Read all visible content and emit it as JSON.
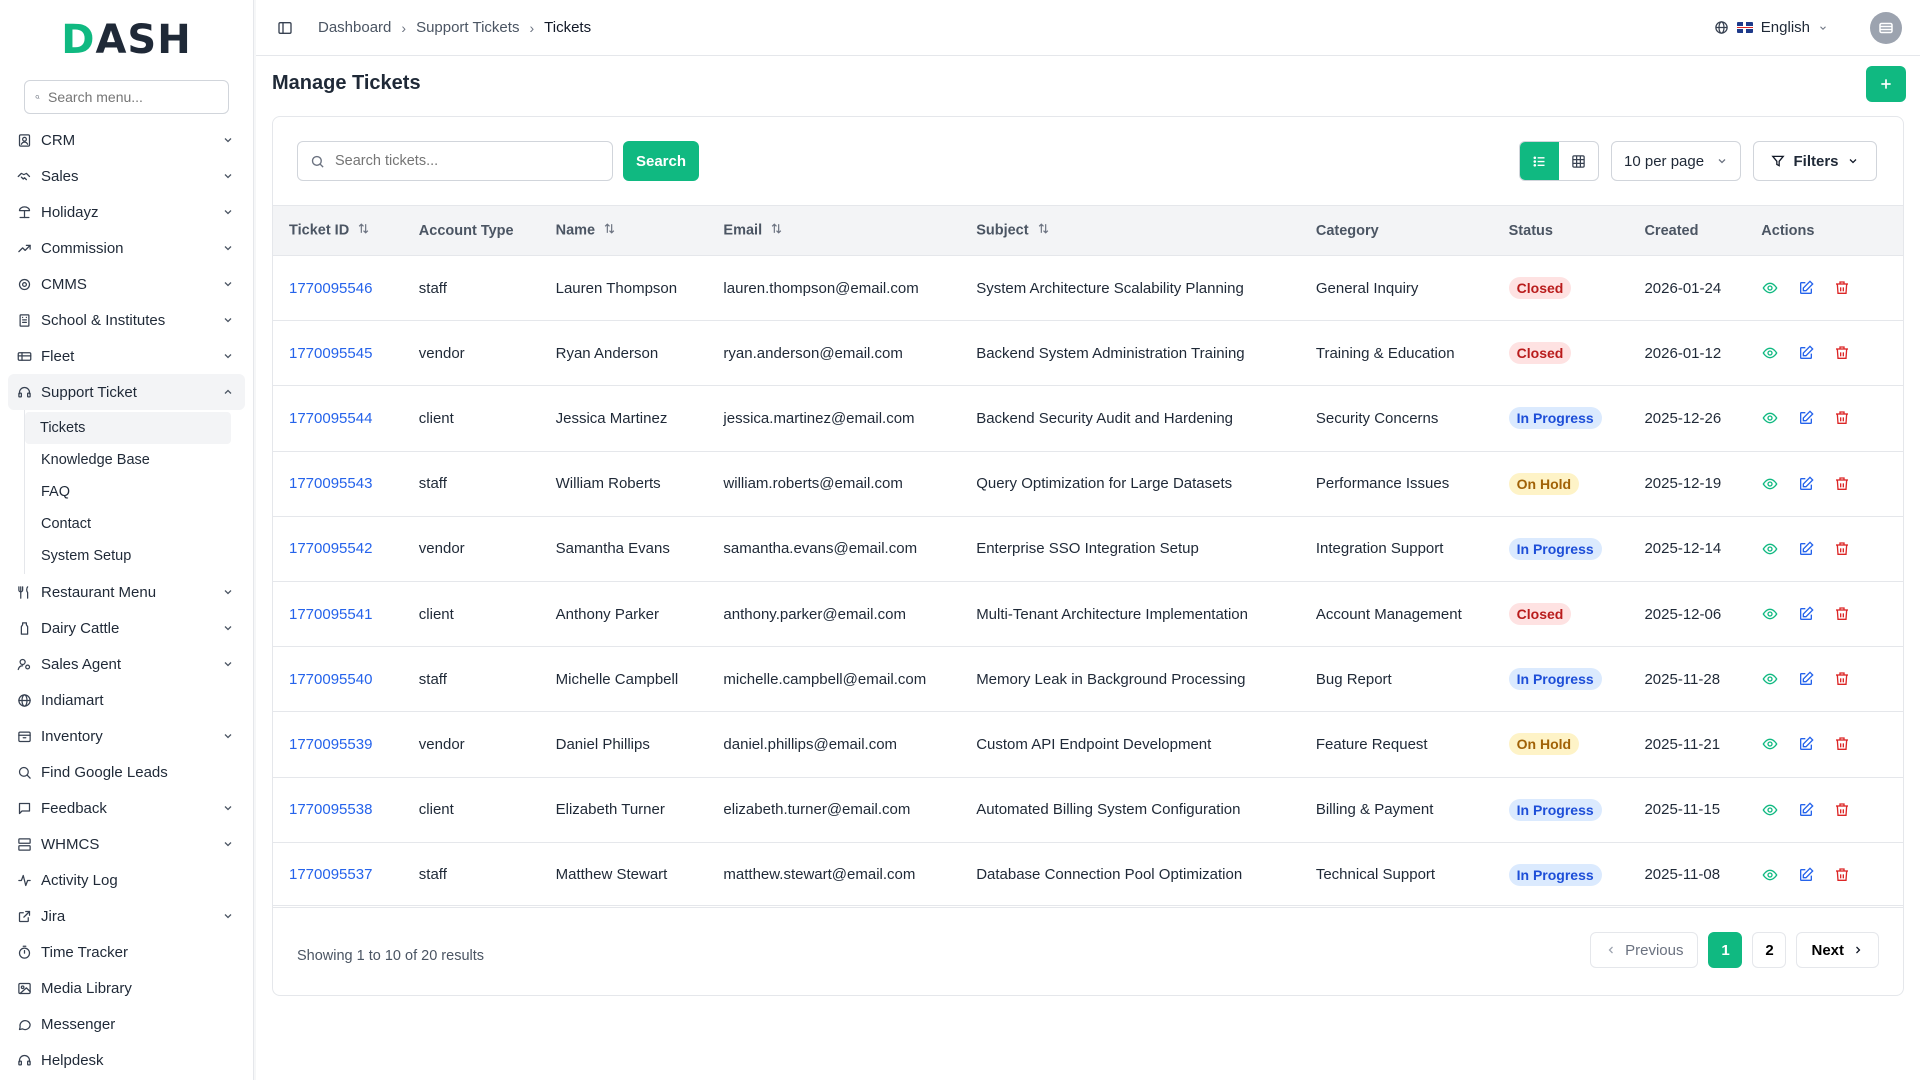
{
  "brand": {
    "logo_first": "D",
    "logo_rest": "ASH",
    "accent": "#10b981"
  },
  "sidebar": {
    "search_placeholder": "Search menu...",
    "items": [
      {
        "label": "CRM",
        "icon": "contact-icon",
        "chevron": true
      },
      {
        "label": "Sales",
        "icon": "handshake-icon",
        "chevron": true
      },
      {
        "label": "Holidayz",
        "icon": "beach-icon",
        "chevron": true
      },
      {
        "label": "Commission",
        "icon": "trend-icon",
        "chevron": true
      },
      {
        "label": "CMMS",
        "icon": "cog-icon",
        "chevron": true
      },
      {
        "label": "School & Institutes",
        "icon": "building-icon",
        "chevron": true
      },
      {
        "label": "Fleet",
        "icon": "truck-icon",
        "chevron": true
      },
      {
        "label": "Support Ticket",
        "icon": "headset-icon",
        "chevron": true,
        "expanded": true
      }
    ],
    "support_sub": [
      "Tickets",
      "Knowledge Base",
      "FAQ",
      "Contact",
      "System Setup"
    ],
    "items_after": [
      {
        "label": "Restaurant Menu",
        "icon": "utensils-icon",
        "chevron": true
      },
      {
        "label": "Dairy Cattle",
        "icon": "milk-icon",
        "chevron": true
      },
      {
        "label": "Sales Agent",
        "icon": "user-cog-icon",
        "chevron": true
      },
      {
        "label": "Indiamart",
        "icon": "globe-icon",
        "chevron": false
      },
      {
        "label": "Inventory",
        "icon": "box-icon",
        "chevron": true
      },
      {
        "label": "Find Google Leads",
        "icon": "search-icon",
        "chevron": false
      },
      {
        "label": "Feedback",
        "icon": "message-icon",
        "chevron": true
      },
      {
        "label": "WHMCS",
        "icon": "server-icon",
        "chevron": true
      },
      {
        "label": "Activity Log",
        "icon": "activity-icon",
        "chevron": false
      },
      {
        "label": "Jira",
        "icon": "external-link-icon",
        "chevron": true
      },
      {
        "label": "Time Tracker",
        "icon": "timer-icon",
        "chevron": false
      },
      {
        "label": "Media Library",
        "icon": "image-icon",
        "chevron": false
      },
      {
        "label": "Messenger",
        "icon": "chat-icon",
        "chevron": false
      },
      {
        "label": "Helpdesk",
        "icon": "headset-icon",
        "chevron": false
      }
    ]
  },
  "header": {
    "breadcrumbs": [
      "Dashboard",
      "Support Tickets",
      "Tickets"
    ],
    "language": "English"
  },
  "page": {
    "title": "Manage Tickets",
    "search_placeholder": "Search tickets...",
    "search_label": "Search",
    "per_page": "10 per page",
    "filters_label": "Filters"
  },
  "table": {
    "columns": [
      "Ticket ID",
      "Account Type",
      "Name",
      "Email",
      "Subject",
      "Category",
      "Status",
      "Created",
      "Actions"
    ],
    "rows": [
      {
        "id": "1770095546",
        "account": "staff",
        "name": "Lauren Thompson",
        "email": "lauren.thompson@email.com",
        "subject": "System Architecture Scalability Planning",
        "category": "General Inquiry",
        "status": "Closed",
        "created": "2026-01-24"
      },
      {
        "id": "1770095545",
        "account": "vendor",
        "name": "Ryan Anderson",
        "email": "ryan.anderson@email.com",
        "subject": "Backend System Administration Training",
        "category": "Training & Education",
        "status": "Closed",
        "created": "2026-01-12"
      },
      {
        "id": "1770095544",
        "account": "client",
        "name": "Jessica Martinez",
        "email": "jessica.martinez@email.com",
        "subject": "Backend Security Audit and Hardening",
        "category": "Security Concerns",
        "status": "In Progress",
        "created": "2025-12-26"
      },
      {
        "id": "1770095543",
        "account": "staff",
        "name": "William Roberts",
        "email": "william.roberts@email.com",
        "subject": "Query Optimization for Large Datasets",
        "category": "Performance Issues",
        "status": "On Hold",
        "created": "2025-12-19"
      },
      {
        "id": "1770095542",
        "account": "vendor",
        "name": "Samantha Evans",
        "email": "samantha.evans@email.com",
        "subject": "Enterprise SSO Integration Setup",
        "category": "Integration Support",
        "status": "In Progress",
        "created": "2025-12-14"
      },
      {
        "id": "1770095541",
        "account": "client",
        "name": "Anthony Parker",
        "email": "anthony.parker@email.com",
        "subject": "Multi-Tenant Architecture Implementation",
        "category": "Account Management",
        "status": "Closed",
        "created": "2025-12-06"
      },
      {
        "id": "1770095540",
        "account": "staff",
        "name": "Michelle Campbell",
        "email": "michelle.campbell@email.com",
        "subject": "Memory Leak in Background Processing",
        "category": "Bug Report",
        "status": "In Progress",
        "created": "2025-11-28"
      },
      {
        "id": "1770095539",
        "account": "vendor",
        "name": "Daniel Phillips",
        "email": "daniel.phillips@email.com",
        "subject": "Custom API Endpoint Development",
        "category": "Feature Request",
        "status": "On Hold",
        "created": "2025-11-21"
      },
      {
        "id": "1770095538",
        "account": "client",
        "name": "Elizabeth Turner",
        "email": "elizabeth.turner@email.com",
        "subject": "Automated Billing System Configuration",
        "category": "Billing & Payment",
        "status": "In Progress",
        "created": "2025-11-15"
      },
      {
        "id": "1770095537",
        "account": "staff",
        "name": "Matthew Stewart",
        "email": "matthew.stewart@email.com",
        "subject": "Database Connection Pool Optimization",
        "category": "Technical Support",
        "status": "In Progress",
        "created": "2025-11-08"
      }
    ]
  },
  "pagination": {
    "summary": "Showing 1 to 10 of 20 results",
    "previous": "Previous",
    "pages": [
      "1",
      "2"
    ],
    "current": "1",
    "next": "Next"
  },
  "colors": {
    "closed": "#b91c1c",
    "in_progress": "#1d4ed8",
    "on_hold": "#a16207",
    "link": "#2563eb"
  }
}
